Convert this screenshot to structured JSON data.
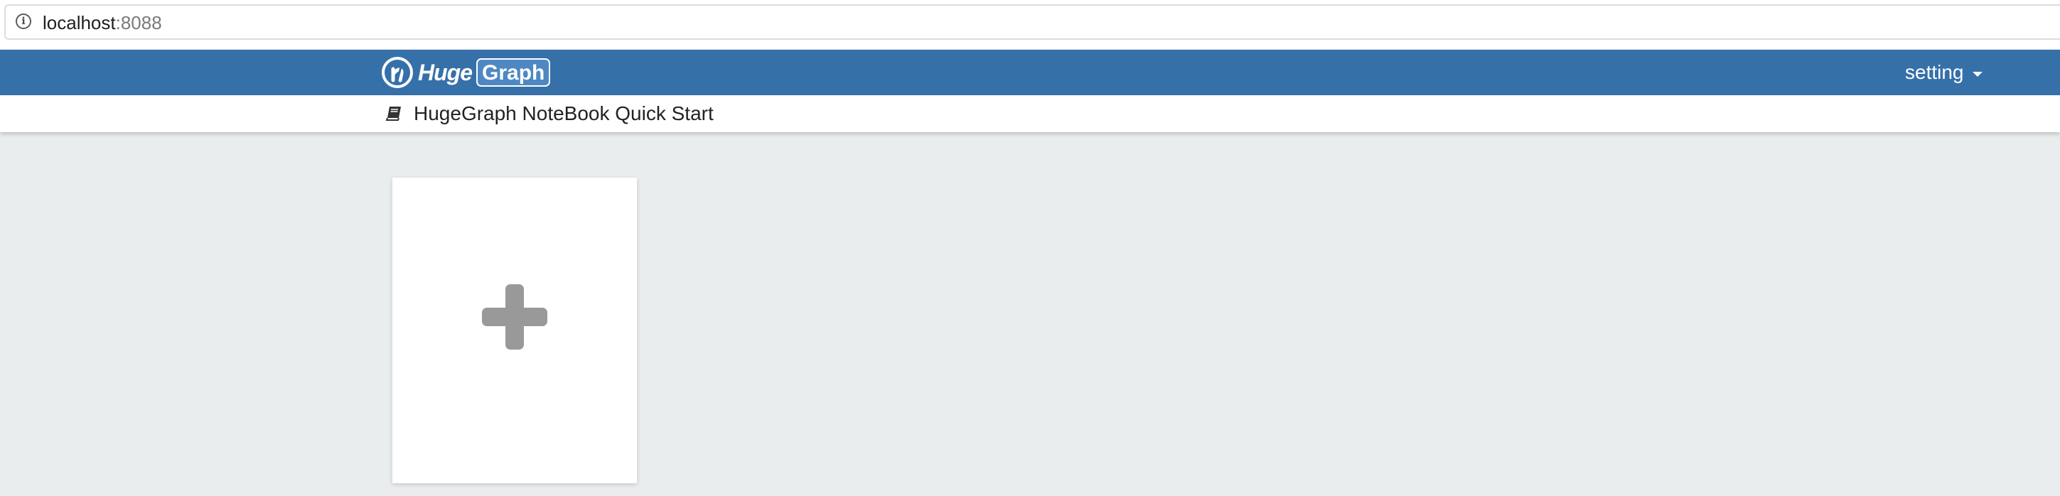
{
  "browser": {
    "url_host": "localhost",
    "url_port": ":8088",
    "info_icon": "info-icon"
  },
  "navbar": {
    "logo": {
      "text_huge": "Huge",
      "text_graph": "Graph",
      "icon": "hugegraph-logo-icon"
    },
    "setting_label": "setting",
    "setting_icon": "caret-down-icon",
    "background_color": "#3670a9"
  },
  "subheader": {
    "icon": "book-icon",
    "title": "HugeGraph NoteBook Quick Start"
  },
  "main": {
    "add_card_icon": "plus-icon",
    "background_color": "#e9edee"
  }
}
